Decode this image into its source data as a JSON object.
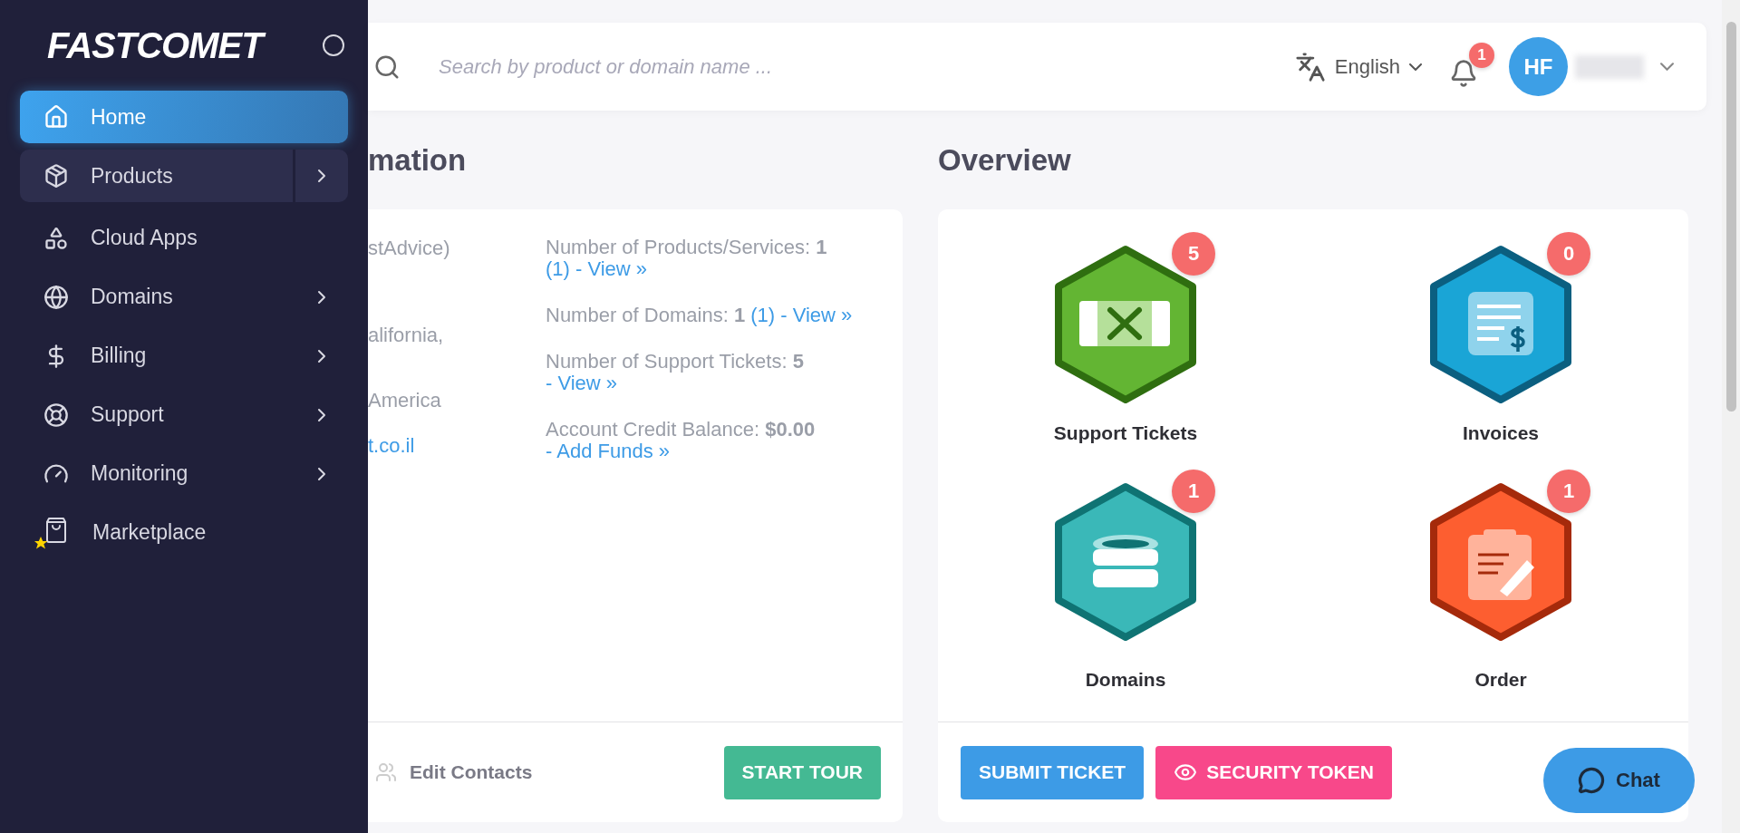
{
  "sidebar": {
    "logo": "FASTCOMET",
    "items": [
      {
        "label": "Home",
        "selected": true,
        "hovered": false,
        "has_submenu": false,
        "kind": "home"
      },
      {
        "label": "Products",
        "selected": false,
        "hovered": true,
        "has_submenu": true,
        "kind": "products"
      },
      {
        "label": "Cloud Apps",
        "selected": false,
        "hovered": false,
        "has_submenu": false,
        "kind": "apps"
      },
      {
        "label": "Domains",
        "selected": false,
        "hovered": false,
        "has_submenu": true,
        "kind": "domains"
      },
      {
        "label": "Billing",
        "selected": false,
        "hovered": false,
        "has_submenu": true,
        "kind": "billing"
      },
      {
        "label": "Support",
        "selected": false,
        "hovered": false,
        "has_submenu": true,
        "kind": "support"
      },
      {
        "label": "Monitoring",
        "selected": false,
        "hovered": false,
        "has_submenu": true,
        "kind": "monitoring"
      },
      {
        "label": "Marketplace",
        "selected": false,
        "hovered": false,
        "has_submenu": false,
        "kind": "marketplace"
      }
    ]
  },
  "header": {
    "search_placeholder": "Search by product or domain name ...",
    "language": "English",
    "notifications": "1",
    "avatar": "HF"
  },
  "account_info": {
    "title": "mation",
    "left_lines": [
      "stAdvice)",
      "alifornia,",
      "America"
    ],
    "left_link": "t.co.il",
    "stats": [
      {
        "label": "Number of Products/Services:",
        "value": "1",
        "link": "(1) - View »"
      },
      {
        "label": "Number of Domains:",
        "value": "1",
        "link": "(1) - View »"
      },
      {
        "label": "Number of Support Tickets:",
        "value": "5",
        "link": "- View »"
      },
      {
        "label": "Account Credit Balance:",
        "value": "$0.00",
        "link": "- Add Funds »"
      }
    ],
    "edit_contacts": "Edit Contacts",
    "start_tour": "START TOUR"
  },
  "overview": {
    "title": "Overview",
    "tiles": [
      {
        "label": "Support Tickets",
        "count": "5",
        "kind": "tickets"
      },
      {
        "label": "Invoices",
        "count": "0",
        "kind": "invoices"
      },
      {
        "label": "Domains",
        "count": "1",
        "kind": "domains"
      },
      {
        "label": "Order",
        "count": "1",
        "kind": "order"
      }
    ],
    "actions": [
      {
        "label": "SUBMIT TICKET",
        "kind": "primary"
      },
      {
        "label": "SECURITY TOKEN",
        "kind": "token"
      }
    ]
  },
  "chat": {
    "label": "Chat"
  }
}
